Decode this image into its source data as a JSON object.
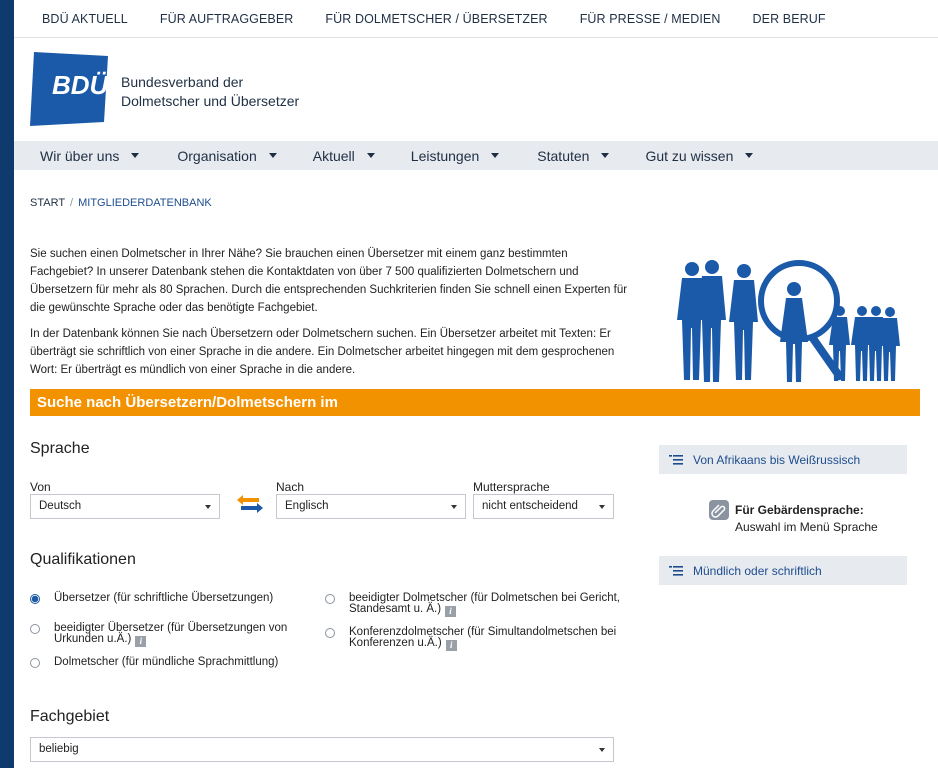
{
  "topnav": [
    "BDÜ AKTUELL",
    "FÜR AUFTRAGGEBER",
    "FÜR DOLMETSCHER / ÜBERSETZER",
    "FÜR PRESSE / MEDIEN",
    "DER BERUF"
  ],
  "brand": {
    "logo": "BDÜ",
    "line1": "Bundesverband der",
    "line2": "Dolmetscher und Übersetzer",
    "color": "#1a5aa8"
  },
  "mainnav": [
    "Wir über uns",
    "Organisation",
    "Aktuell",
    "Leistungen",
    "Statuten",
    "Gut zu wissen"
  ],
  "breadcrumb": {
    "start": "START",
    "sep": "/",
    "current": "MITGLIEDERDATENBANK"
  },
  "intro": {
    "p1": "Sie suchen einen Dolmetscher in Ihrer Nähe? Sie brauchen einen Übersetzer mit einem ganz bestimmten Fachgebiet? In unserer Datenbank stehen die Kontaktdaten von über 7 500 qualifizierten Dolmetschern und Übersetzern für mehr als 80 Sprachen. Durch die entsprechenden Suchkriterien finden Sie schnell einen Experten für die gewünschte Sprache oder das benötigte Fachgebiet.",
    "p2": "In der Datenbank können Sie nach Übersetzern oder Dolmetschern suchen. Ein Übersetzer arbeitet mit Texten: Er überträgt sie schriftlich von einer Sprache in die andere. Ein Dolmetscher arbeitet hingegen mit dem gesprochenen Wort: Er überträgt es mündlich von einer Sprache in die andere."
  },
  "banner": {
    "title": "Suche nach Übersetzern/Dolmetschern im",
    "color": "#f39200"
  },
  "sprache": {
    "heading": "Sprache",
    "von_label": "Von",
    "von_value": "Deutsch",
    "nach_label": "Nach",
    "nach_value": "Englisch",
    "mutter_label": "Muttersprache",
    "mutter_value": "nicht entscheidend"
  },
  "qualifikationen": {
    "heading": "Qualifikationen",
    "options": [
      {
        "label": "Übersetzer (für schriftliche Übersetzungen)",
        "selected": true
      },
      {
        "label": "beeidigter Übersetzer (für Übersetzungen von Urkunden u.Ä.)",
        "selected": false
      },
      {
        "label": "Dolmetscher (für mündliche Sprachmittlung)",
        "selected": false
      },
      {
        "label": "beeidigter Dolmetscher (für Dolmetschen bei Gericht, Standesamt u. Ä.)",
        "selected": false
      },
      {
        "label": "Konferenzdolmetscher (für Simultandolmetschen bei Konferenzen u.Ä.)",
        "selected": false
      }
    ]
  },
  "fachgebiet": {
    "heading": "Fachgebiet",
    "value": "beliebig"
  },
  "sidebar": {
    "box1": "Von Afrikaans bis Weißrussisch",
    "gebaerden_title": "Für Gebärdensprache:",
    "gebaerden_sub": "Auswahl im Menü Sprache",
    "box2": "Mündlich oder schriftlich"
  }
}
